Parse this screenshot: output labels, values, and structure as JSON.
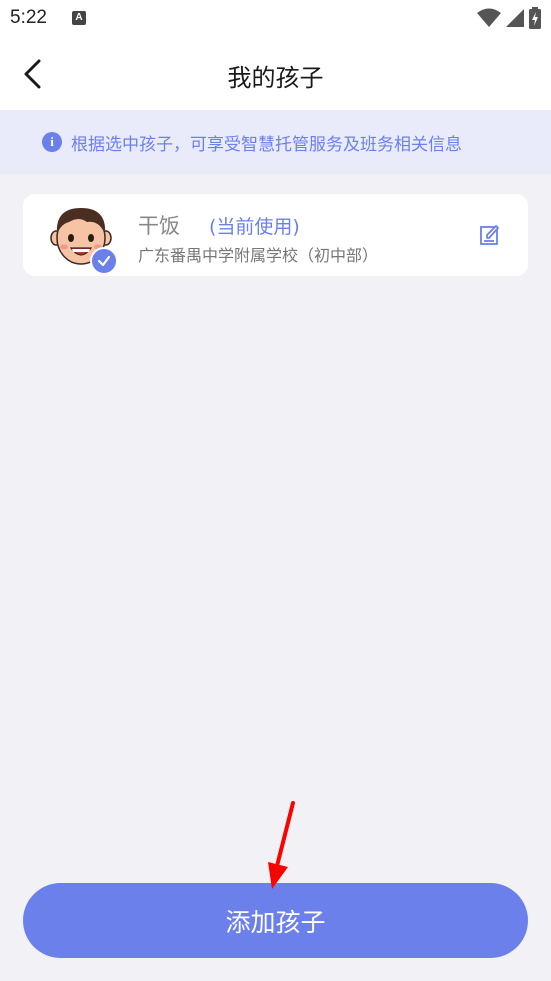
{
  "status_bar": {
    "time": "5:22",
    "notification_badge": "A"
  },
  "header": {
    "title": "我的孩子",
    "back_icon": "chevron-left-icon"
  },
  "banner": {
    "icon": "info-icon",
    "icon_glyph": "i",
    "text": "根据选中孩子，可享受智慧托管服务及班务相关信息"
  },
  "children": [
    {
      "name": "干饭",
      "status": "(当前使用)",
      "school": "广东番禺中学附属学校（初中部）",
      "selected": true
    }
  ],
  "actions": {
    "add_child_label": "添加孩子"
  },
  "colors": {
    "accent": "#6c80ec",
    "banner_bg": "#e9ebfa",
    "page_bg": "#f2f2f6",
    "annotation_arrow": "#ff0000"
  }
}
